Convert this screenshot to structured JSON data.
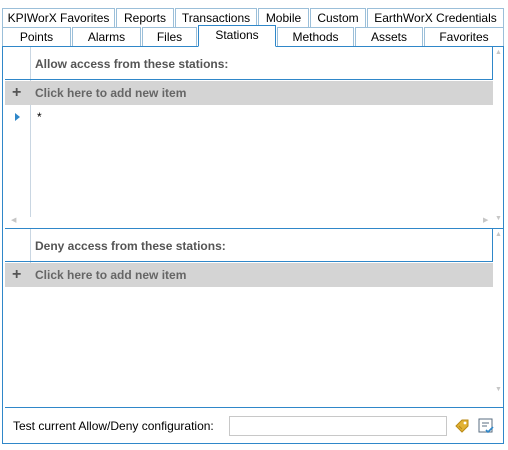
{
  "tabs": {
    "row1": [
      "KPIWorX Favorites",
      "Reports",
      "Transactions",
      "Mobile",
      "Custom",
      "EarthWorX Credentials"
    ],
    "row2": [
      "Points",
      "Alarms",
      "Files",
      "Stations",
      "Methods",
      "Assets",
      "Favorites"
    ],
    "active": "Stations"
  },
  "allow": {
    "header": "Allow access from these stations:",
    "add_label": "Click here to add new item",
    "rows": [
      "*"
    ]
  },
  "deny": {
    "header": "Deny access from these stations:",
    "add_label": "Click here to add new item"
  },
  "footer": {
    "label": "Test current Allow/Deny configuration:",
    "input_value": ""
  },
  "colors": {
    "accent": "#2f87c9",
    "add_row_bg": "#d4d4d4",
    "tag_icon": "#e2b233"
  },
  "icons": {
    "add": "plus-icon",
    "row_indicator": "current-row-arrow-icon",
    "test": "tag-icon",
    "verify": "checklist-icon"
  }
}
